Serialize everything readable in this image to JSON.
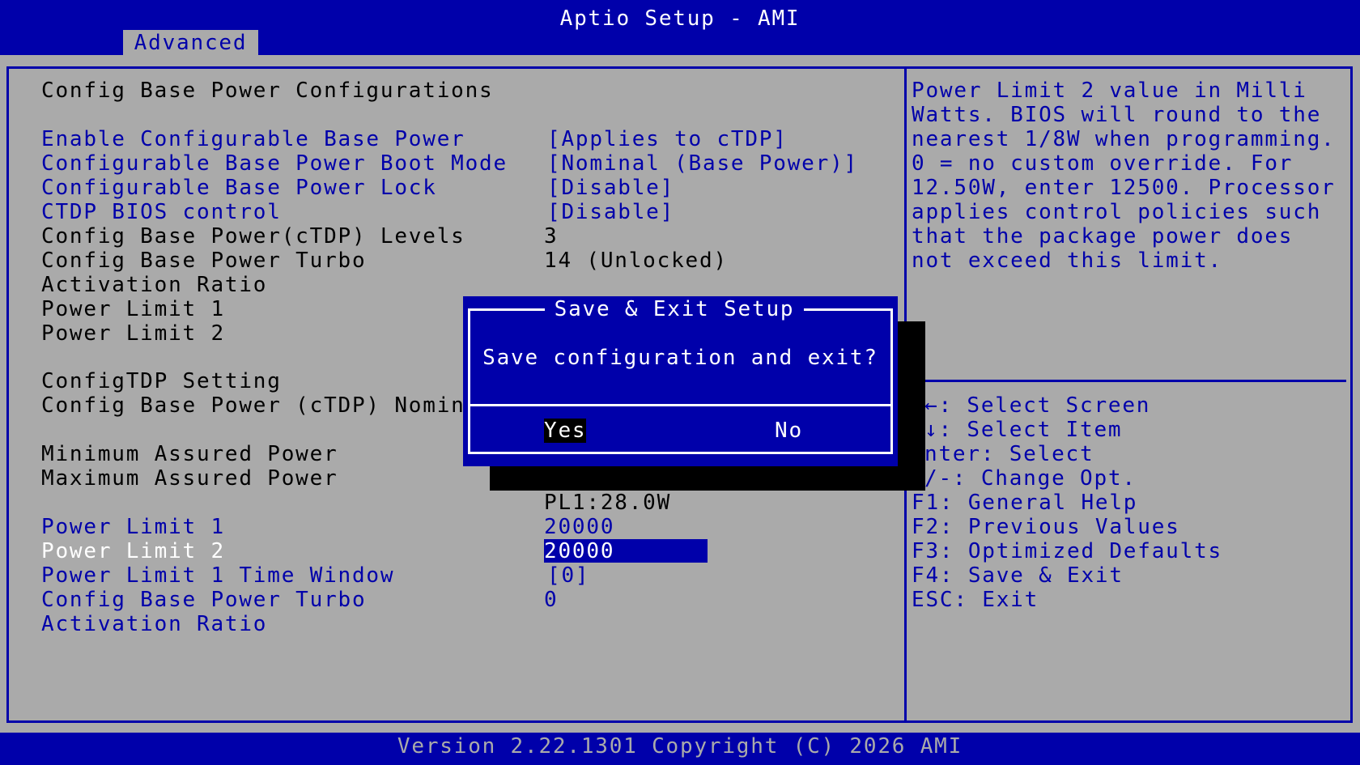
{
  "window": {
    "title": "Aptio Setup - AMI",
    "active_tab": "Advanced"
  },
  "settings": {
    "section_title": "Config Base Power Configurations",
    "rows": [
      {
        "label": "Enable Configurable Base Power",
        "value": "[Applies to cTDP]"
      },
      {
        "label": "Configurable Base Power Boot Mode",
        "value": "[Nominal (Base Power)]"
      },
      {
        "label": "Configurable Base Power Lock",
        "value": "[Disable]"
      },
      {
        "label": "CTDP BIOS control",
        "value": "[Disable]"
      },
      {
        "label": "Config Base Power(cTDP) Levels",
        "value": "3"
      },
      {
        "label": "Config Base Power Turbo",
        "value": "14 (Unlocked)"
      },
      {
        "label": "Activation Ratio"
      },
      {
        "label": "Power Limit 1"
      },
      {
        "label": "Power Limit 2"
      },
      {
        "label": "ConfigTDP Setting"
      },
      {
        "label": "Config Base Power (cTDP) Nomina"
      },
      {
        "label": "Minimum Assured Power"
      },
      {
        "label": "Maximum Assured Power"
      },
      {
        "value": "PL1:28.0W"
      },
      {
        "label": "Power Limit 1",
        "value": "20000"
      },
      {
        "label": "Power Limit 2",
        "value": "20000"
      },
      {
        "label": "Power Limit 1 Time Window",
        "value": "[0]"
      },
      {
        "label": "Config Base Power Turbo",
        "value": "0"
      },
      {
        "label": "Activation Ratio"
      }
    ]
  },
  "help": {
    "lines": [
      "Power Limit 2 value in Milli",
      "Watts. BIOS will round to the",
      "nearest 1/8W when programming.",
      "0 = no custom override. For",
      "12.50W, enter 12500. Processor",
      "applies control policies such",
      "that the package power does",
      "not exceed this limit."
    ]
  },
  "keys": [
    "←: Select Screen",
    "↓: Select Item",
    "nter: Select",
    "/-: Change Opt.",
    "F1: General Help",
    "F2: Previous Values",
    "F3: Optimized Defaults",
    "F4: Save & Exit",
    "ESC: Exit"
  ],
  "dialog": {
    "title": "Save & Exit Setup",
    "message": "Save configuration and exit?",
    "yes_label": "Yes",
    "no_label": "No"
  },
  "footer": {
    "text": "Version 2.22.1301 Copyright (C) 2026 AMI"
  },
  "colors": {
    "background": "#0000aa",
    "panel": "#aaaaaa",
    "highlight": "#ffffff"
  }
}
